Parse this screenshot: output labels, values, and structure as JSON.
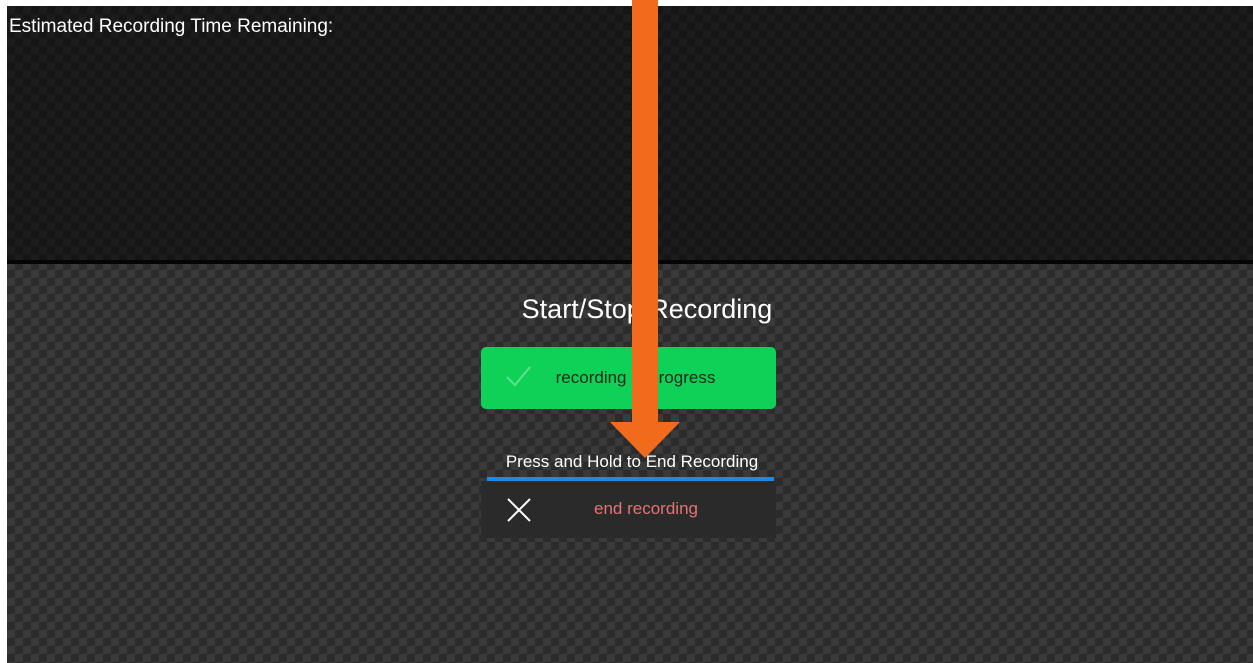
{
  "recording_panel": {
    "time_remaining_label": "Estimated Recording Time Remaining:"
  },
  "controls": {
    "section_title": "Start/Stop Recording",
    "status_button": {
      "label": "recording in progress",
      "icon": "check-icon",
      "color": "#10d158"
    },
    "hold_instruction": "Press and Hold to End Recording",
    "hold_progress_color": "#1e88e5",
    "end_button": {
      "label": "end recording",
      "icon": "close-icon",
      "label_color": "#e57373"
    }
  },
  "annotation": {
    "arrow_color": "#f26b1d",
    "arrow_direction": "down"
  }
}
